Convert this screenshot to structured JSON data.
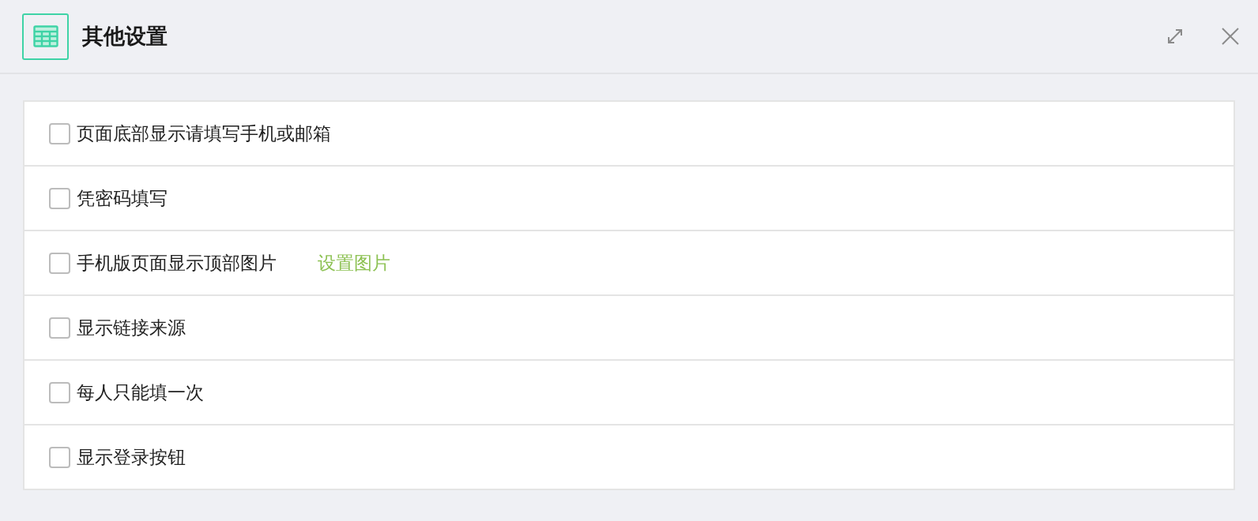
{
  "dialog": {
    "title": "其他设置"
  },
  "options": [
    {
      "label": "页面底部显示请填写手机或邮箱",
      "checked": false
    },
    {
      "label": "凭密码填写",
      "checked": false
    },
    {
      "label": "手机版页面显示顶部图片",
      "checked": false,
      "link": "设置图片"
    },
    {
      "label": "显示链接来源",
      "checked": false
    },
    {
      "label": "每人只能填一次",
      "checked": false
    },
    {
      "label": "显示登录按钮",
      "checked": false
    }
  ]
}
